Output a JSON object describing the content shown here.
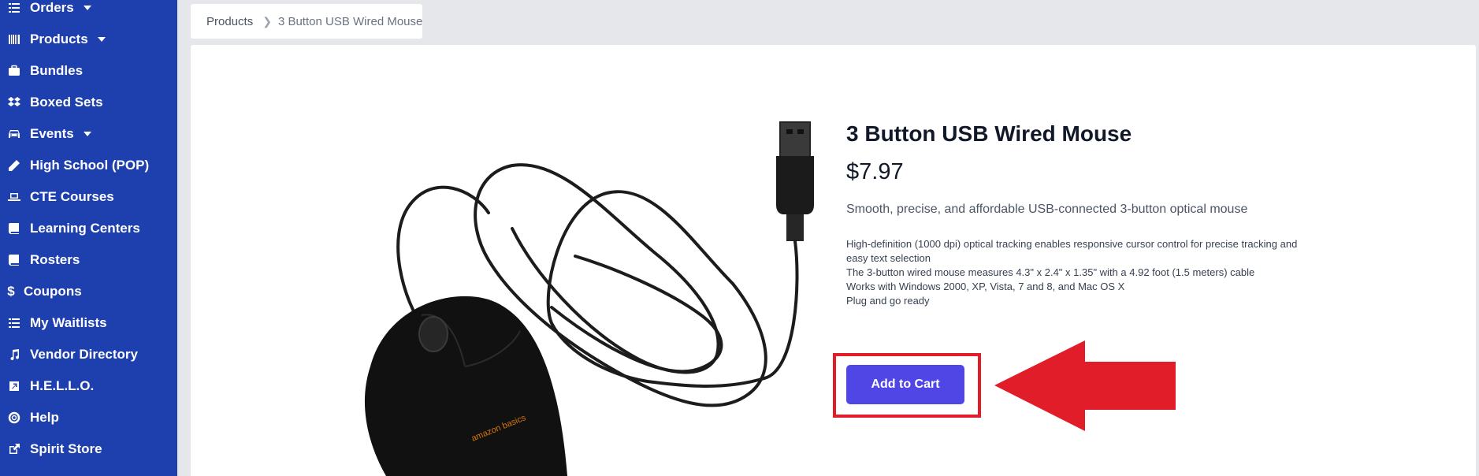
{
  "sidebar": {
    "items": [
      {
        "label": "Orders",
        "icon": "list-icon",
        "has_caret": true
      },
      {
        "label": "Products",
        "icon": "barcode-icon",
        "has_caret": true
      },
      {
        "label": "Bundles",
        "icon": "briefcase-icon",
        "has_caret": false
      },
      {
        "label": "Boxed Sets",
        "icon": "dropbox-icon",
        "has_caret": false
      },
      {
        "label": "Events",
        "icon": "car-icon",
        "has_caret": true
      },
      {
        "label": "High School (POP)",
        "icon": "pencil-icon",
        "has_caret": false
      },
      {
        "label": "CTE Courses",
        "icon": "laptop-icon",
        "has_caret": false
      },
      {
        "label": "Learning Centers",
        "icon": "book-icon",
        "has_caret": false
      },
      {
        "label": "Rosters",
        "icon": "book-icon",
        "has_caret": false
      },
      {
        "label": "Coupons",
        "icon": "dollar-icon",
        "has_caret": false
      },
      {
        "label": "My Waitlists",
        "icon": "list-icon",
        "has_caret": false
      },
      {
        "label": "Vendor Directory",
        "icon": "music-icon",
        "has_caret": false
      },
      {
        "label": "H.E.L.L.O.",
        "icon": "external-square-icon",
        "has_caret": false
      },
      {
        "label": "Help",
        "icon": "lifebuoy-icon",
        "has_caret": false
      },
      {
        "label": "Spirit Store",
        "icon": "external-link-icon",
        "has_caret": false
      }
    ]
  },
  "breadcrumb": {
    "root": "Products",
    "current": "3 Button USB Wired Mouse"
  },
  "product": {
    "title": "3 Button USB Wired Mouse",
    "price": "$7.97",
    "subtitle": "Smooth, precise, and affordable USB-connected 3-button optical mouse",
    "features": [
      "High-definition (1000 dpi) optical tracking enables responsive cursor control for precise tracking and easy text selection",
      "The 3-button wired mouse measures 4.3\" x 2.4\" x 1.35\" with a 4.92 foot (1.5 meters) cable",
      "Works with Windows 2000, XP, Vista, 7 and 8, and Mac OS X",
      "Plug and go ready"
    ],
    "add_to_cart_label": "Add to Cart",
    "image_brand_text": "amazon basics"
  },
  "colors": {
    "sidebar_bg": "#1e3fae",
    "button_bg": "#4f46e5",
    "highlight": "#e11d2a"
  }
}
